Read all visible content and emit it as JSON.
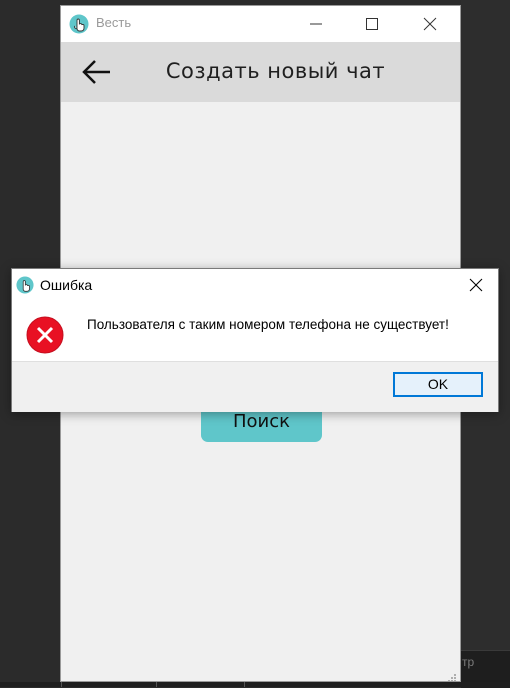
{
  "app": {
    "title": "Весть",
    "header_title": "Создать новый чат",
    "search_button_label": "Поиск"
  },
  "dialog": {
    "title": "Ошибка",
    "message": "Пользователя с таким номером телефона не существует!",
    "ok_label": "OK"
  },
  "background": {
    "partial_text": "тр"
  },
  "icons": {
    "app_icon": "hand-pointer-icon",
    "back": "arrow-left-icon",
    "minimize": "minimize-icon",
    "maximize": "maximize-icon",
    "close": "close-icon",
    "error": "error-icon"
  },
  "colors": {
    "accent_button": "#5fc6ca",
    "header_bg": "#dadada",
    "error_red": "#e81123",
    "ok_border": "#0078d7"
  }
}
